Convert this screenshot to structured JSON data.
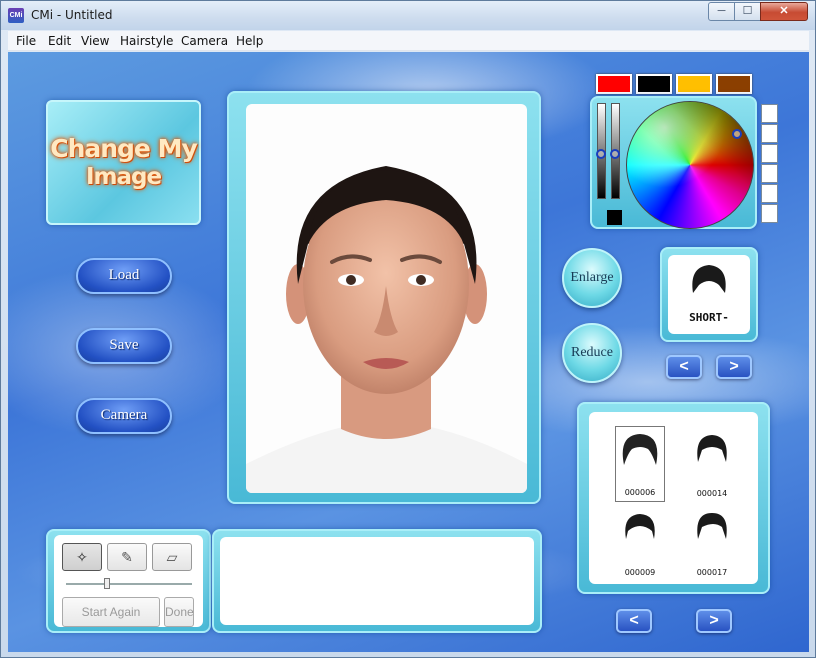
{
  "window": {
    "icon_text": "CMi",
    "title": "CMi - Untitled",
    "minimize": "─",
    "maximize": "☐",
    "close": "✕"
  },
  "menu": [
    {
      "label": "File"
    },
    {
      "label": "Edit"
    },
    {
      "label": "View"
    },
    {
      "label": "Hairstyle"
    },
    {
      "label": "Camera"
    },
    {
      "label": "Help"
    }
  ],
  "logo": {
    "line1": "Change My",
    "line2": "Image"
  },
  "buttons": {
    "load": "Load",
    "save": "Save",
    "camera": "Camera",
    "enlarge": "Enlarge",
    "reduce": "Reduce"
  },
  "colors": {
    "swatches": [
      "#ff0000",
      "#000000",
      "#ffbf00",
      "#8b3f00"
    ],
    "current": "#000000"
  },
  "hairstyle_preview": {
    "name": "SHORT-",
    "prev": "<",
    "next": ">"
  },
  "hairstyles": [
    {
      "id": "000006",
      "selected": true
    },
    {
      "id": "000014",
      "selected": false
    },
    {
      "id": "000009",
      "selected": false
    },
    {
      "id": "000017",
      "selected": false
    }
  ],
  "grid_nav": {
    "prev": "<",
    "next": ">"
  },
  "tools": {
    "wand_icon": "✧",
    "pencil_icon": "✎",
    "eraser_icon": "▱",
    "start_again": "Start Again",
    "done": "Done"
  }
}
